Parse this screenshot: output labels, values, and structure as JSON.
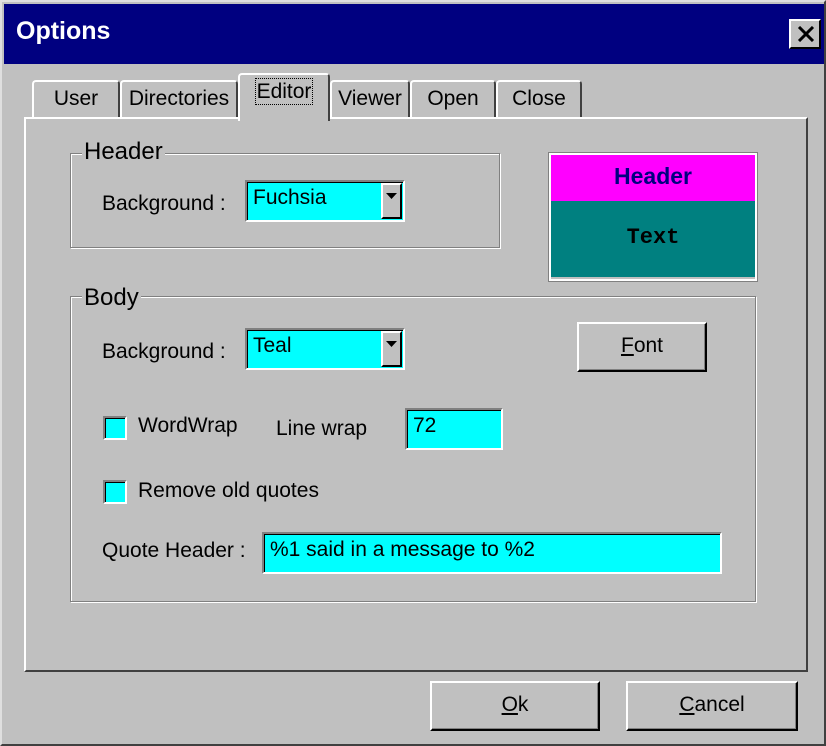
{
  "window": {
    "title": "Options",
    "close_symbol": "close-icon"
  },
  "tabs": [
    {
      "label": "User"
    },
    {
      "label": "Directories"
    },
    {
      "label": "Editor",
      "active": true
    },
    {
      "label": "Viewer"
    },
    {
      "label": "Open"
    },
    {
      "label": "Close"
    }
  ],
  "header_group": {
    "legend": "Header",
    "background_label": "Background :",
    "background_value": "Fuchsia"
  },
  "preview": {
    "header_text": "Header",
    "body_text": "Text",
    "header_color": "#ff00ff",
    "body_color": "#008080"
  },
  "body_group": {
    "legend": "Body",
    "background_label": "Background :",
    "background_value": "Teal",
    "font_button": {
      "label_first": "F",
      "label_rest": "ont"
    },
    "wordwrap_label": "WordWrap",
    "wordwrap_checked": false,
    "line_wrap_label": "Line wrap",
    "line_wrap_value": "72",
    "remove_quotes_label": "Remove old quotes",
    "remove_quotes_checked": false,
    "quote_header_label": "Quote Header :",
    "quote_header_value": "%1 said in a message to %2"
  },
  "buttons": {
    "ok": {
      "label_first": "O",
      "label_rest": "k"
    },
    "cancel": {
      "label_first": "C",
      "label_rest": "ancel"
    }
  },
  "colors": {
    "input_bg": "#00ffff",
    "titlebar": "#000080",
    "dialog_bg": "#c0c0c0"
  }
}
